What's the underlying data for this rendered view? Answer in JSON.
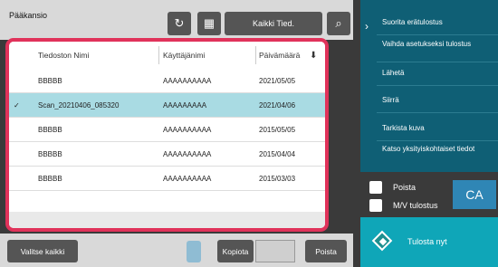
{
  "header": {
    "title": "Pääkansio",
    "all_files_label": "Kaikki Tied."
  },
  "icons": {
    "refresh": "refresh-icon",
    "grid": "grid-icon",
    "search": "search-icon",
    "chevron": "chevron-right-icon",
    "sort": "sort-down-icon",
    "check": "check-icon"
  },
  "table": {
    "columns": [
      "Tiedoston Nimi",
      "Käyttäjänimi",
      "Päivämäärä"
    ],
    "rows": [
      {
        "name": "BBBBB",
        "user": "AAAAAAAAAA",
        "date": "2021/05/05",
        "selected": false
      },
      {
        "name": "Scan_20210406_085320",
        "user": "AAAAAAAAA",
        "date": "2021/04/06",
        "selected": true
      },
      {
        "name": "BBBBB",
        "user": "AAAAAAAAAA",
        "date": "2015/05/05",
        "selected": false
      },
      {
        "name": "BBBBB",
        "user": "AAAAAAAAAA",
        "date": "2015/04/04",
        "selected": false
      },
      {
        "name": "BBBBB",
        "user": "AAAAAAAAAA",
        "date": "2015/03/03",
        "selected": false
      }
    ]
  },
  "actions": {
    "items": [
      "Suorita erätulostus",
      "Vaihda asetukseksi tulostus",
      "Lähetä",
      "Siirrä",
      "Tarkista kuva",
      "Katso yksityiskohtaiset tiedot"
    ]
  },
  "options": {
    "delete_label": "Poista",
    "mv_label": "M/V tulostus"
  },
  "ca_label": "CA",
  "bottom": {
    "select_all": "Valitse kaikki",
    "copies": "Kopiota",
    "delete": "Poista"
  },
  "print_now": "Tulosta nyt",
  "colors": {
    "accent": "#e0325a",
    "panel": "#0f5f75",
    "print": "#0fa6b8",
    "selected_row": "#a9dbe3"
  }
}
